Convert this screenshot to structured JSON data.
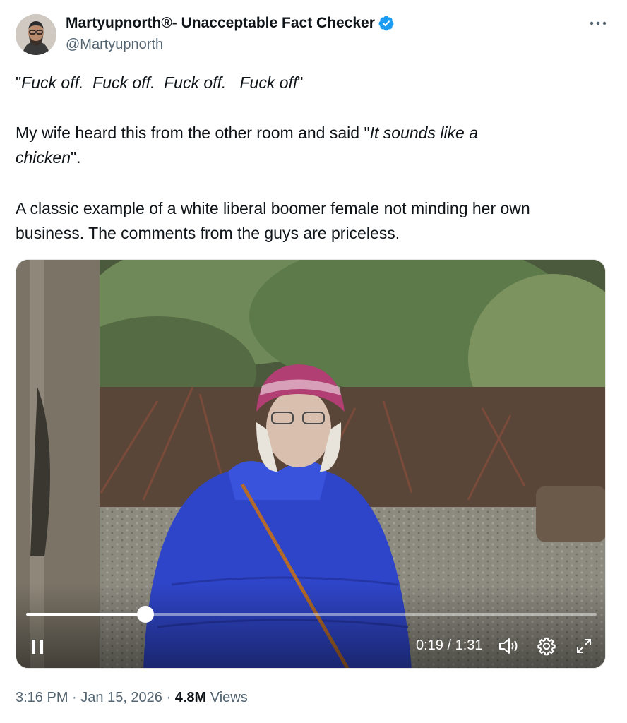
{
  "author": {
    "display_name": "Martyupnorth®- Unacceptable Fact Checker",
    "handle": "@Martyupnorth",
    "avatar_icon": "user-avatar",
    "verified_icon": "verified-badge-icon",
    "verified_color": "#1d9bf0"
  },
  "more_icon": "more-horizontal-icon",
  "body": {
    "line1": {
      "q1": "\"",
      "quote": "Fuck off.  Fuck off.  Fuck off.   Fuck off",
      "q2": "\""
    },
    "line2": {
      "pre": "My wife heard this from the other room and said \"",
      "italic": "It sounds like a"
    },
    "line3": {
      "italic": "chicken",
      "post": "\"."
    },
    "line4": "A classic example of a white liberal boomer female not minding her own",
    "line5": "business.  The comments from the guys are priceless."
  },
  "video": {
    "progress": 0.2088,
    "elapsed": "0:19",
    "separator": " / ",
    "duration": "1:31",
    "pause_icon": "pause-icon",
    "volume_icon": "volume-icon",
    "settings_icon": "gear-icon",
    "fullscreen_icon": "expand-icon"
  },
  "meta": {
    "time": "3:16 PM",
    "dot1": " · ",
    "date": "Jan 15, 2026",
    "dot2": " · ",
    "views_count": "4.8M",
    "views_label": " Views"
  },
  "colors": {
    "text": "#0f1419",
    "secondary": "#536471",
    "jacket": "#2f45c9"
  }
}
